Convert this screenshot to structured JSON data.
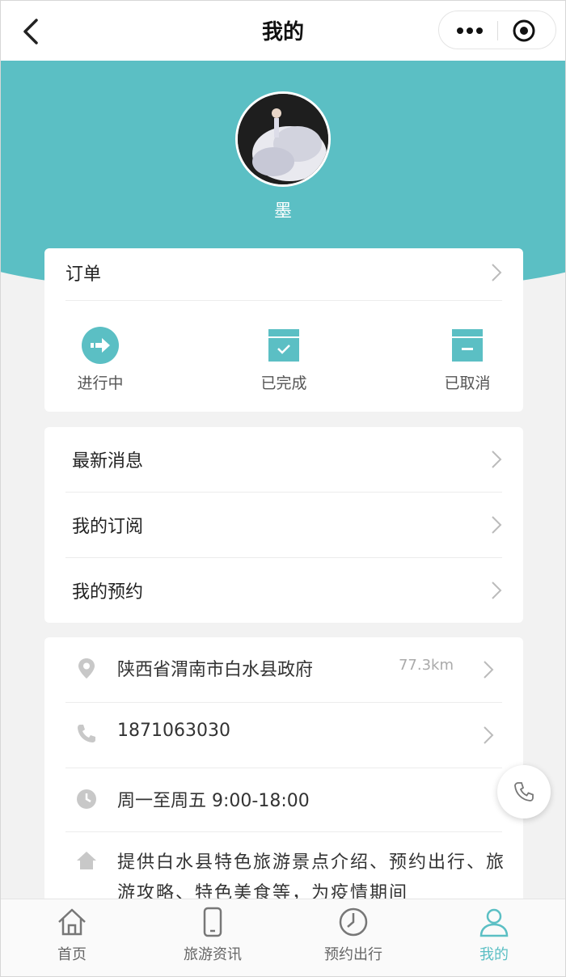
{
  "navbar": {
    "title": "我的",
    "back_icon": "chevron-left-icon",
    "more_icon": "more-dots-icon",
    "close_icon": "target-circle-icon"
  },
  "profile": {
    "username": "墨",
    "avatar_icon": "avatar-photo"
  },
  "orders": {
    "title": "订单",
    "items": [
      {
        "label": "进行中",
        "icon": "arrow-circle-icon"
      },
      {
        "label": "已完成",
        "icon": "box-check-icon"
      },
      {
        "label": "已取消",
        "icon": "box-minus-icon"
      }
    ]
  },
  "menu": {
    "items": [
      {
        "label": "最新消息"
      },
      {
        "label": "我的订阅"
      },
      {
        "label": "我的预约"
      }
    ]
  },
  "info": {
    "address": "陕西省渭南市白水县政府",
    "distance": "77.3km",
    "phone": "1871063030",
    "hours": "周一至周五 9:00-18:00",
    "description": "提供白水县特色旅游景点介绍、预约出行、旅游攻略、特色美食等，为疫情期间"
  },
  "tabbar": {
    "items": [
      {
        "label": "首页",
        "icon": "home-icon"
      },
      {
        "label": "旅游资讯",
        "icon": "phone-device-icon"
      },
      {
        "label": "预约出行",
        "icon": "clock-icon"
      },
      {
        "label": "我的",
        "icon": "user-icon"
      }
    ],
    "active_index": 3
  },
  "colors": {
    "accent": "#5bbfc4",
    "background": "#f2f2f2"
  }
}
